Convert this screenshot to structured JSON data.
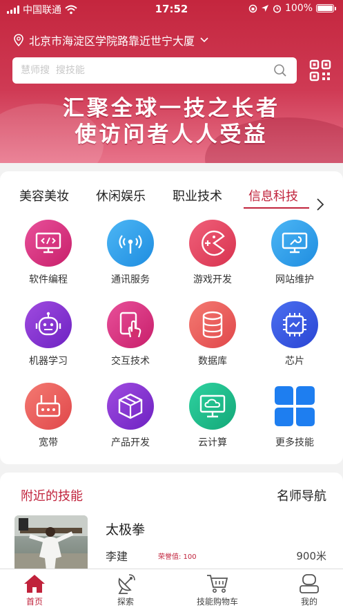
{
  "status_bar": {
    "carrier": "中国联通",
    "time": "17:52",
    "battery": "100%"
  },
  "header": {
    "location": "北京市海淀区学院路靠近世宁大厦",
    "search_placeholder": "慧师搜  搜技能",
    "slogan_line1": "汇聚全球一技之长者",
    "slogan_line2": "使访问者人人受益",
    "accent_color": "#c4263e"
  },
  "categories": {
    "tabs": [
      {
        "label": "美容美妆",
        "active": false
      },
      {
        "label": "休闲娱乐",
        "active": false
      },
      {
        "label": "职业技术",
        "active": false
      },
      {
        "label": "信息科技",
        "active": true
      }
    ],
    "items": [
      {
        "label": "软件编程",
        "icon": "code-monitor-icon"
      },
      {
        "label": "通讯服务",
        "icon": "antenna-icon"
      },
      {
        "label": "游戏开发",
        "icon": "pacman-icon"
      },
      {
        "label": "网站维护",
        "icon": "wrench-monitor-icon"
      },
      {
        "label": "机器学习",
        "icon": "robot-icon"
      },
      {
        "label": "交互技术",
        "icon": "touch-icon"
      },
      {
        "label": "数据库",
        "icon": "database-icon"
      },
      {
        "label": "芯片",
        "icon": "chip-icon"
      },
      {
        "label": "宽带",
        "icon": "router-icon"
      },
      {
        "label": "产品开发",
        "icon": "cube-icon"
      },
      {
        "label": "云计算",
        "icon": "cloud-monitor-icon"
      },
      {
        "label": "更多技能",
        "icon": "more-grid-icon"
      }
    ]
  },
  "nearby": {
    "title": "附近的技能",
    "nav": "名师导航",
    "skill": {
      "name": "太极拳",
      "teacher": "李建",
      "honor": "荣誉值: 100",
      "distance": "900米"
    }
  },
  "tabbar": [
    {
      "label": "首页",
      "icon": "home-icon",
      "active": true
    },
    {
      "label": "探索",
      "icon": "satellite-dish-icon",
      "active": false
    },
    {
      "label": "技能购物车",
      "icon": "cart-icon",
      "active": false
    },
    {
      "label": "我的",
      "icon": "user-icon",
      "active": false
    }
  ]
}
